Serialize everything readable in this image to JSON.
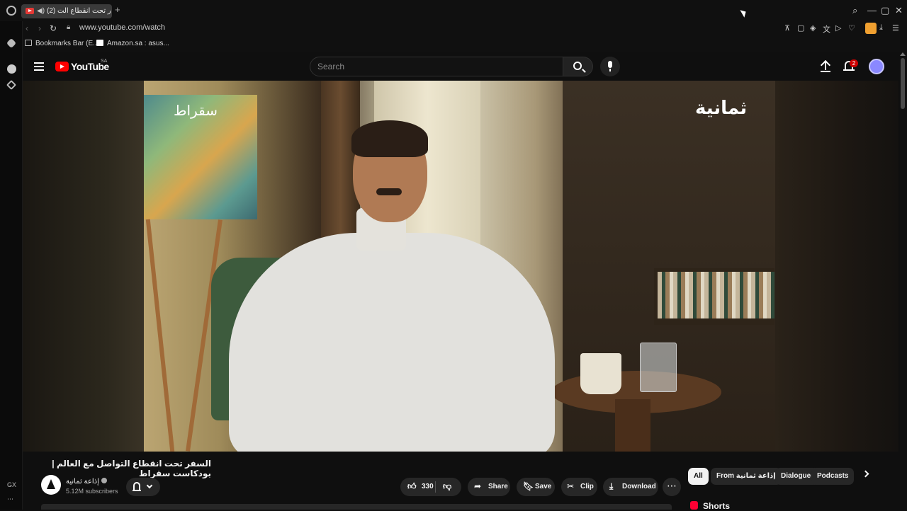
{
  "browser": {
    "tab_title": "(2) السفر تحت انقطاع الت",
    "new_tab_glyph": "+",
    "url": "www.youtube.com/watch",
    "bookmarks": [
      {
        "label": "Bookmarks Bar (E..."
      },
      {
        "label": "Amazon.sa : asus..."
      }
    ],
    "side_label": "GX",
    "side_more": "⋯",
    "window_controls": {
      "search": "⌕",
      "minimize": "—",
      "maximize": "▢",
      "close": "✕"
    }
  },
  "youtube": {
    "logo_text": "YouTube",
    "country_code": "SA",
    "search_placeholder": "Search",
    "notification_count": "2",
    "colors": {
      "brand_red": "#ff0000",
      "background": "#0f0f0f",
      "pill": "#272727"
    }
  },
  "player": {
    "watermark_left": "سقراط",
    "watermark_right": "ثمانية"
  },
  "video": {
    "title": "السفر تحت انقطاع التواصل مع العالم | بودكاست سقراط",
    "channel_name": "إذاعة ثمانية",
    "subscribers": "5.12M subscribers",
    "likes": "330",
    "actions": {
      "share": "Share",
      "save": "Save",
      "clip": "Clip",
      "download": "Download",
      "more": "⋯"
    }
  },
  "filters": {
    "chips": [
      "All",
      "From إذاعة ثمانية",
      "Dialogues",
      "Podcasts"
    ]
  },
  "shorts": {
    "label": "Shorts"
  }
}
